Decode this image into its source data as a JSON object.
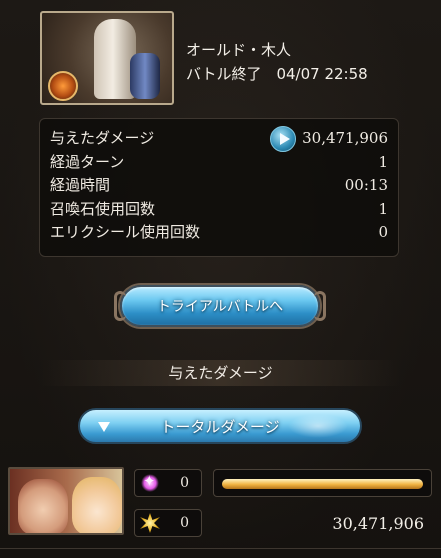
{
  "header": {
    "enemy_name": "オールド・木人",
    "status_line": "バトル終了　04/07 22:58"
  },
  "stats": [
    {
      "label": "与えたダメージ",
      "value": "30,471,906"
    },
    {
      "label": "経過ターン",
      "value": "1"
    },
    {
      "label": "経過時間",
      "value": "00:13"
    },
    {
      "label": "召喚石使用回数",
      "value": "1"
    },
    {
      "label": "エリクシール使用回数",
      "value": "0"
    }
  ],
  "buttons": {
    "trial_battle": "トライアルバトルへ",
    "total_damage": "トータルダメージ"
  },
  "section": {
    "damage_heading": "与えたダメージ"
  },
  "character": {
    "skill_count": "0",
    "ougi_count": "0",
    "damage": "30,471,906",
    "damage_share": 1.0
  },
  "colors": {
    "accent_blue": "#3a9ad0",
    "bar_gold": "#f0b341"
  }
}
